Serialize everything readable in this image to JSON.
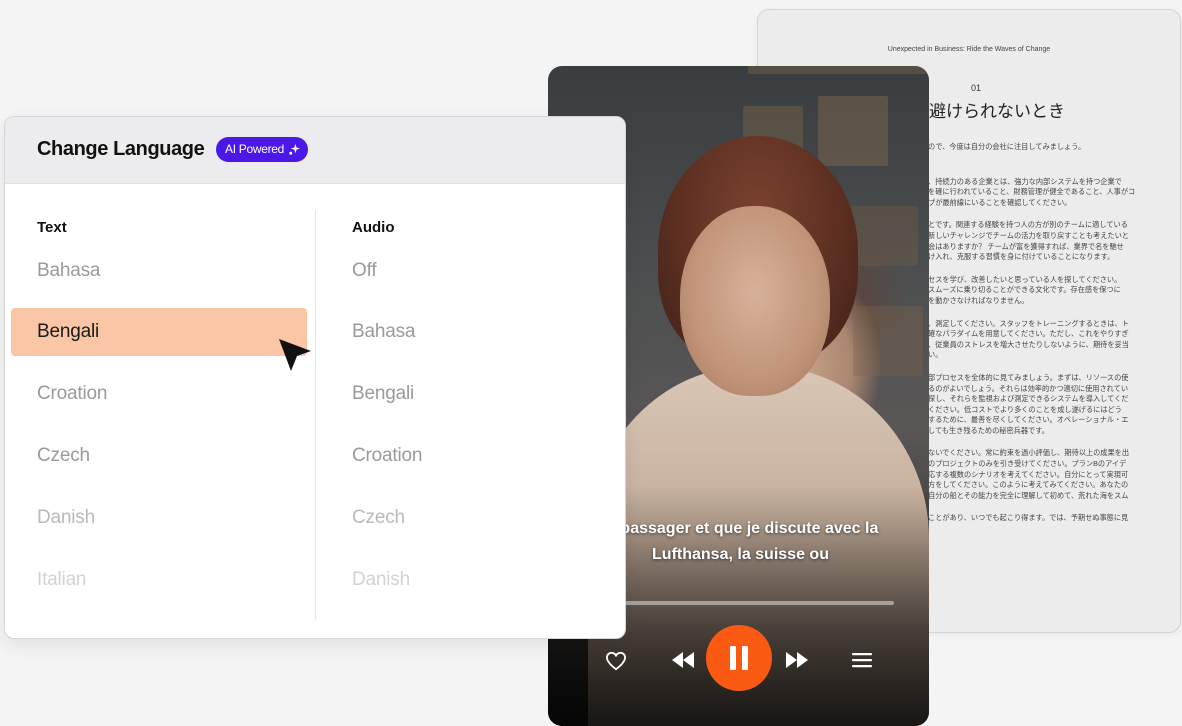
{
  "document": {
    "header": "Unexpected in Business: Ride the Waves of Change",
    "chapter_number": "01",
    "chapter_title": "避けられないとき",
    "paragraphs": [
      [
        "ので、今度は自分の会社に注目してみましょう。"
      ],
      [
        "、持続力のある企業とは、強力な内部システムを持つ企業で",
        "を確に行われていること、財務管理が健全であること、人事がコ",
        "プが最前線にいることを確認してください。"
      ],
      [
        "とです。関連する経験を持つ人の方が別のチームに適している",
        "新しいチャレンジでチームの活力を取り戻すことも考えたいと",
        "会はありますか？ チームが富を獲得すれば、業界で名を馳せ",
        "け入れ、克服する習慣を身に付けていることになります。"
      ],
      [
        "セスを学び、改善したいと思っている人を探してください。",
        "スムーズに乗り切ることができる文化です。存在感を保つに",
        "を動かさなければなりません。"
      ],
      [
        "、測定してください。スタッフをトレーニングするときは、ト",
        "確なパラダイムを用意してください。ただし、これをやりすぎ",
        "、従業員のストレスを増大させたりしないように、期待を妥当",
        "い。"
      ],
      [
        "部プロセスを全体的に見てみましょう。まずは、リソースの使",
        "るのがよいでしょう。それらは効率的かつ適切に使用されてい",
        "探し、それらを監視および測定できるシステムを導入してくだ",
        "ください。低コストでより多くのことを成し遂げるにはどう",
        "するために、最善を尽くしてください。オペレーショナル・エ",
        "しても生き残るための秘密兵器です。"
      ],
      [
        "ないでください。常に約束を過小評価し、期待以上の成果を出",
        "のプロジェクトのみを引き受けてください。プランBのアイデ",
        "応する複数のシナリオを考えてください。自分にとって実現可",
        "方をしてください。このように考えてみてください。あなたの",
        "自分の船とその能力を完全に理解して初めて、荒れた海をスム"
      ],
      [
        "ことがあり、いつでも起こり得ます。では、予期せぬ事態に見"
      ]
    ]
  },
  "player": {
    "subtitle_line1": "is passager et que je discute avec la",
    "subtitle_line2": "Lufthansa, la suisse ou",
    "progress_fraction": 0,
    "controls": [
      "heart-icon",
      "rewind-icon",
      "pause-icon",
      "forward-icon",
      "menu-icon"
    ],
    "accent_color": "#fb5a12"
  },
  "language_panel": {
    "title": "Change Language",
    "badge": "AI Powered",
    "badge_color": "#4b18e8",
    "selected_highlight_color": "#fbc6a6",
    "text_column": {
      "label": "Text",
      "items": [
        "Bahasa",
        "Bengali",
        "Croation",
        "Czech",
        "Danish",
        "Italian"
      ],
      "selected": "Bengali"
    },
    "audio_column": {
      "label": "Audio",
      "items": [
        "Off",
        "Bahasa",
        "Bengali",
        "Croation",
        "Czech",
        "Danish"
      ]
    }
  }
}
